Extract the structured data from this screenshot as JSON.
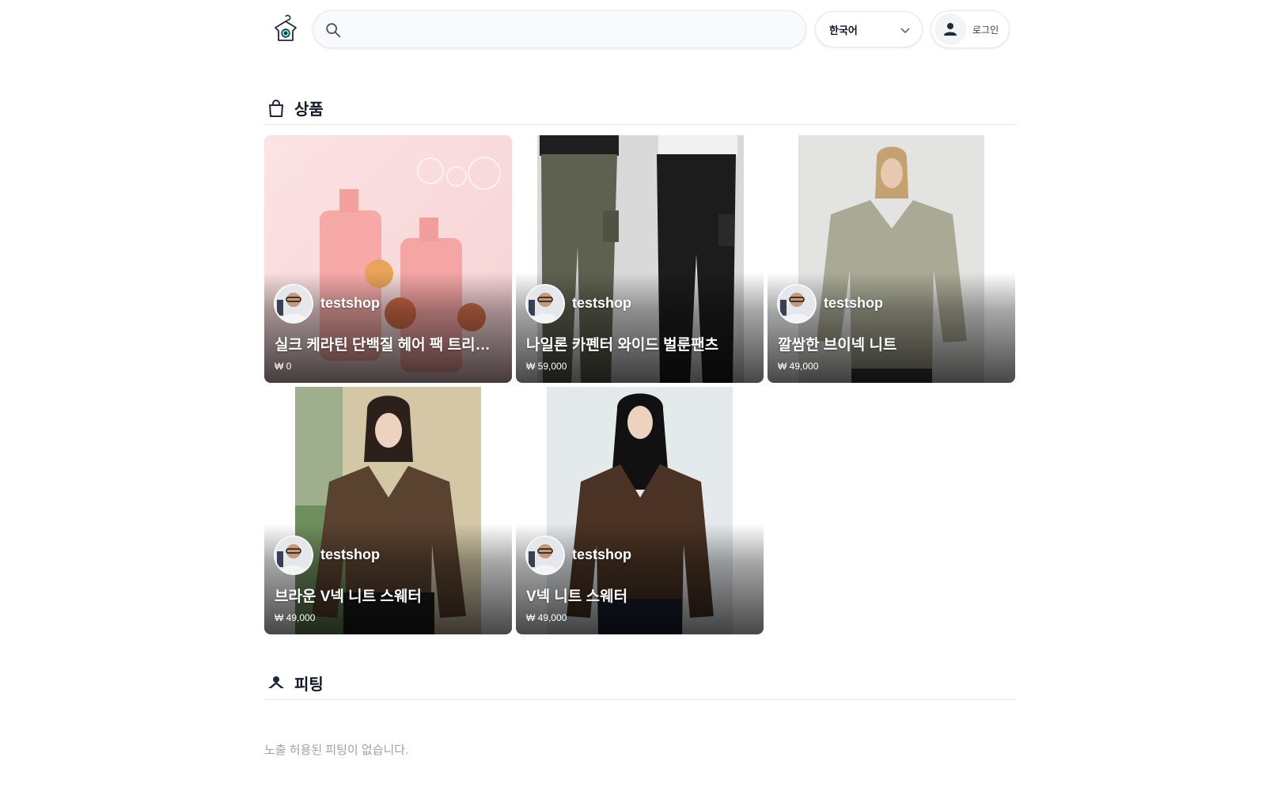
{
  "header": {
    "search_placeholder": "",
    "language_label": "한국어",
    "login_label": "로그인"
  },
  "products_section": {
    "title": "상품"
  },
  "products": [
    {
      "shop": "testshop",
      "name": "실크 케라틴 단백질 헤어 팩 트리트먼트",
      "price": "₩ 0"
    },
    {
      "shop": "testshop",
      "name": "나일론 카펜터 와이드 벌룬팬츠",
      "price": "₩ 59,000"
    },
    {
      "shop": "testshop",
      "name": "깔쌈한 브이넥 니트",
      "price": "₩ 49,000"
    },
    {
      "shop": "testshop",
      "name": "브라운 V넥 니트 스웨터",
      "price": "₩ 49,000"
    },
    {
      "shop": "testshop",
      "name": "V넥 니트 스웨터",
      "price": "₩ 49,000"
    }
  ],
  "fitting_section": {
    "title": "피팅",
    "empty_message": "노출 허용된 피팅이 없습니다."
  },
  "colors": {
    "text_primary": "#111827",
    "text_muted": "#9ca3af",
    "border": "#e5e7eb",
    "accent": "#1e3a5f"
  }
}
